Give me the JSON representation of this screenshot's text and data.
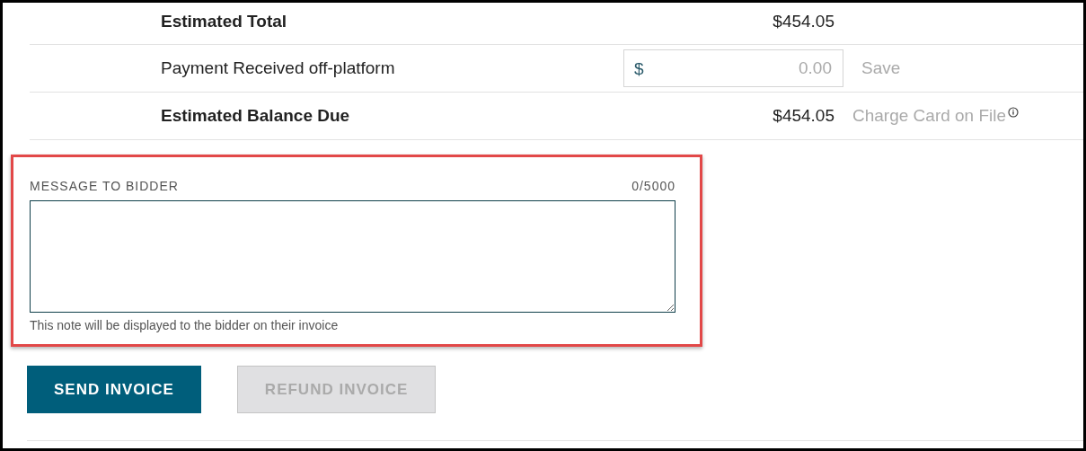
{
  "summary_rows": [
    {
      "kind": "amount",
      "label": "Estimated Total",
      "bold": true,
      "amount": "$454.05"
    },
    {
      "kind": "payment_input",
      "label": "Payment Received off-platform",
      "bold": false,
      "currency": "$",
      "placeholder": "0.00",
      "action": "Save"
    },
    {
      "kind": "amount",
      "label": "Estimated Balance Due",
      "bold": true,
      "amount": "$454.05",
      "action": "Charge Card on File",
      "info": true
    }
  ],
  "message": {
    "highlighted": true,
    "label": "MESSAGE TO BIDDER",
    "counter": "0/5000",
    "hint": "This note will be displayed to the bidder on their invoice"
  },
  "buttons": [
    {
      "label": "SEND INVOICE",
      "disabled": false
    },
    {
      "label": "REFUND INVOICE",
      "disabled": true
    }
  ]
}
